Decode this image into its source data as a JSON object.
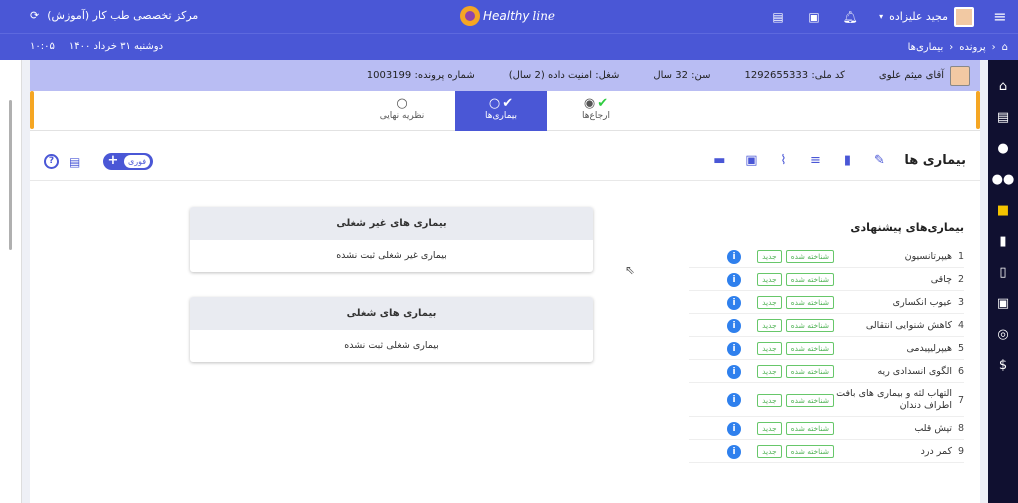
{
  "header": {
    "center_name": "مرکز تخصصی طب کار (آموزش)",
    "logo_text": "Healthy",
    "logo_text2": "line",
    "user_name": "مجید علیزاده",
    "icons": [
      "menu-icon",
      "chevron-down-icon",
      "bell-icon",
      "folder-add-icon",
      "chat-alert-icon",
      "refresh-icon"
    ]
  },
  "subheader": {
    "breadcrumb": [
      "پرونده",
      "بیماری‌ها"
    ],
    "date": "دوشنبه ۳۱ خرداد ۱۴۰۰",
    "time": "۱۰:۰۵"
  },
  "patient": {
    "name": "آقای میثم علوی",
    "national_id": "کد ملی: 1292655333",
    "age": "سن: 32 سال",
    "job": "شغل: امنیت داده (2 سال)",
    "file_no": "شماره پرونده: 1003199"
  },
  "steps": [
    {
      "label": "ارجاع‌ها"
    },
    {
      "label": "بیماری‌ها"
    },
    {
      "label": "نظریه نهایی"
    }
  ],
  "toolbar": {
    "title": "بیماری ها",
    "pill_label": "فوری"
  },
  "suggested": {
    "title": "بیماری‌های پیشنهادی",
    "badge_known": "شناخته شده",
    "badge_new": "جدید",
    "items": [
      {
        "num": "1",
        "name": "هیپرتانسیون"
      },
      {
        "num": "2",
        "name": "چاقی"
      },
      {
        "num": "3",
        "name": "عیوب انکساری"
      },
      {
        "num": "4",
        "name": "کاهش شنوایی انتقالی"
      },
      {
        "num": "5",
        "name": "هیپرلیپیدمی"
      },
      {
        "num": "6",
        "name": "الگوی انسدادی ریه"
      },
      {
        "num": "7",
        "name": "التهاب لثه و بیماری های بافت اطراف دندان"
      },
      {
        "num": "8",
        "name": "تپش قلب"
      },
      {
        "num": "9",
        "name": "کمر درد"
      }
    ]
  },
  "cards": [
    {
      "title": "بیماری های غیر شغلی",
      "empty": "بیماری غیر شغلی ثبت نشده"
    },
    {
      "title": "بیماری های شغلی",
      "empty": "بیماری شغلی ثبت نشده"
    }
  ]
}
